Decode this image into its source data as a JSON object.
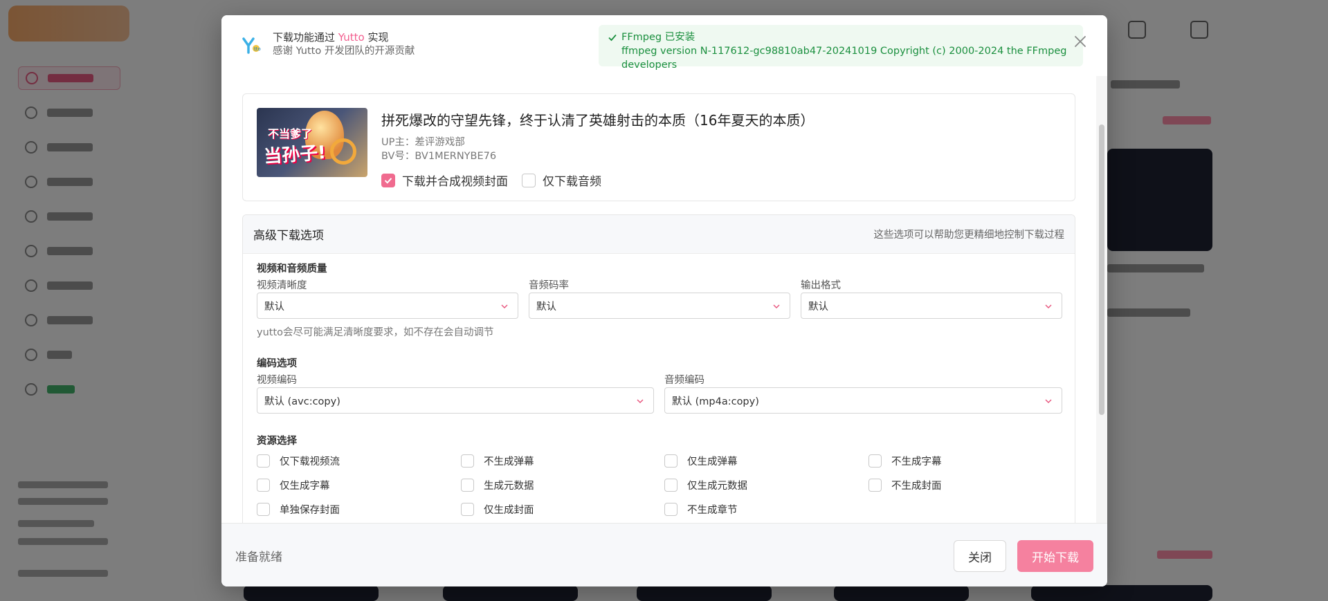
{
  "header": {
    "intro_prefix": "下载功能通过",
    "intro_brand": "Yutto",
    "intro_suffix": "实现",
    "intro_thanks": "感谢 Yutto 开发团队的开源贡献",
    "ffmpeg_status": "FFmpeg 已安装",
    "ffmpeg_version": "ffmpeg version N-117612-gc98810ab47-20241019 Copyright (c) 2000-2024 the FFmpeg developers",
    "close_icon": "close-icon"
  },
  "video": {
    "title": "拼死爆改的守望先锋，终于认清了英雄射击的本质（16年夏天的本质）",
    "uploader": "UP主：差评游戏部",
    "bvid": "BV号：BV1MERNYBE76",
    "thumb_text_1": "不当爹了",
    "thumb_text_2": "当孙子!",
    "options": [
      {
        "label": "下载并合成视频封面",
        "checked": true
      },
      {
        "label": "仅下载音频",
        "checked": false
      }
    ]
  },
  "advanced": {
    "title": "高级下载选项",
    "hint": "这些选项可以帮助您更精细地控制下载过程",
    "quality_section": "视频和音频质量",
    "video_quality_label": "视频清晰度",
    "video_quality_value": "默认",
    "audio_bitrate_label": "音频码率",
    "audio_bitrate_value": "默认",
    "output_format_label": "输出格式",
    "output_format_value": "默认",
    "quality_help": "yutto会尽可能满足清晰度要求，如不存在会自动调节",
    "codec_section": "编码选项",
    "video_codec_label": "视频编码",
    "video_codec_value": "默认 (avc:copy)",
    "audio_codec_label": "音频编码",
    "audio_codec_value": "默认 (mp4a:copy)",
    "resource_section": "资源选择",
    "resources": [
      "仅下载视频流",
      "不生成弹幕",
      "仅生成弹幕",
      "不生成字幕",
      "仅生成字幕",
      "生成元数据",
      "仅生成元数据",
      "不生成封面",
      "单独保存封面",
      "仅生成封面",
      "不生成章节"
    ]
  },
  "footer": {
    "status": "准备就绪",
    "close_label": "关闭",
    "start_label": "开始下载"
  },
  "colors": {
    "accent": "#f5819f",
    "success": "#1a8f3e"
  }
}
